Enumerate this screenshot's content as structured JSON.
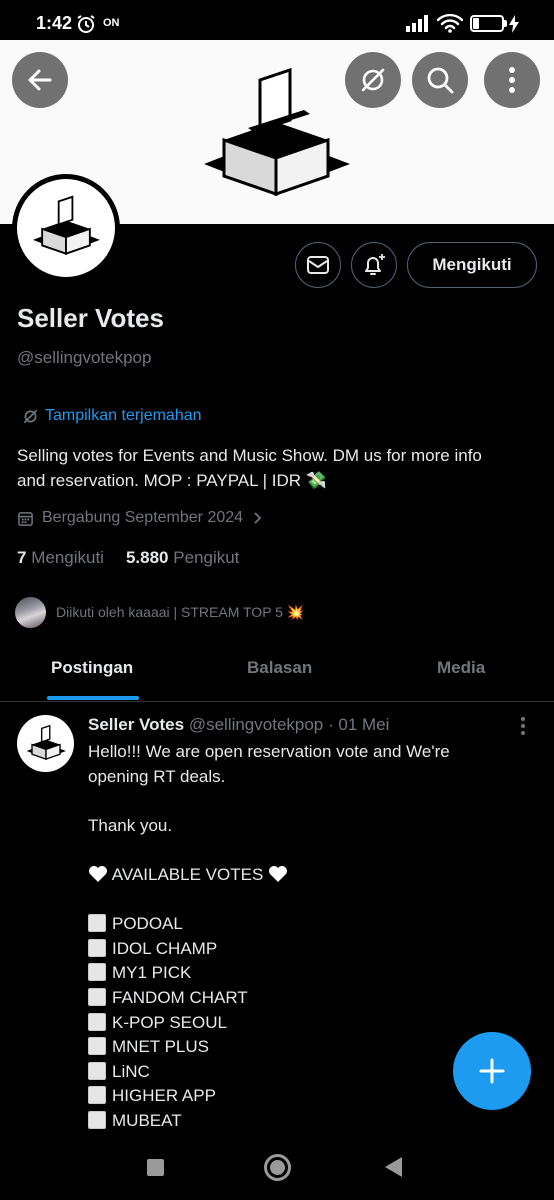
{
  "status_bar": {
    "time": "1:42",
    "on_label": "ON",
    "battery": "23",
    "battery_level": 0.23
  },
  "icons": {
    "back": "arrow-left-icon",
    "translate": "translate-icon",
    "search": "search-icon",
    "more": "more-vertical-icon",
    "message": "mail-icon",
    "notify": "bell-plus-icon",
    "calendar": "calendar-icon",
    "chevron": "chevron-right-icon",
    "compose": "plus-icon"
  },
  "colors": {
    "accent": "#1d9bf0",
    "text": "#e7e9ea",
    "muted": "#71767b",
    "background": "#000000"
  },
  "profile": {
    "follow_button": "Mengikuti",
    "name": "Seller Votes",
    "handle": "@sellingvotekpop",
    "translate_label": "Tampilkan terjemahan",
    "bio_line1": "Selling votes for Events and Music Show.  DM us for more info",
    "bio_line2": "and reservation. MOP : PAYPAL | IDR 💸",
    "joined": "Bergabung September 2024",
    "following_count": "7",
    "following_label": "Mengikuti",
    "followers_count": "5.880",
    "followers_label": "Pengikut",
    "followed_by": "Diikuti oleh kaaaai | STREAM TOP 5 💥"
  },
  "tabs": [
    {
      "label": "Postingan",
      "active": true
    },
    {
      "label": "Balasan",
      "active": false
    },
    {
      "label": "Media",
      "active": false
    }
  ],
  "post": {
    "author": "Seller Votes",
    "meta": "@sellingvotekpop · 01 Mei",
    "line1": "Hello!!! We are open reservation vote and We're",
    "line2": "opening RT deals.",
    "thanks": "Thank you.",
    "available_header": "AVAILABLE VOTES",
    "votes": [
      "PODOAL",
      "IDOL CHAMP",
      "MY1 PICK",
      "FANDOM CHART",
      "K-POP SEOUL",
      "MNET PLUS",
      "LiNC",
      "HIGHER APP",
      "MUBEAT"
    ]
  }
}
